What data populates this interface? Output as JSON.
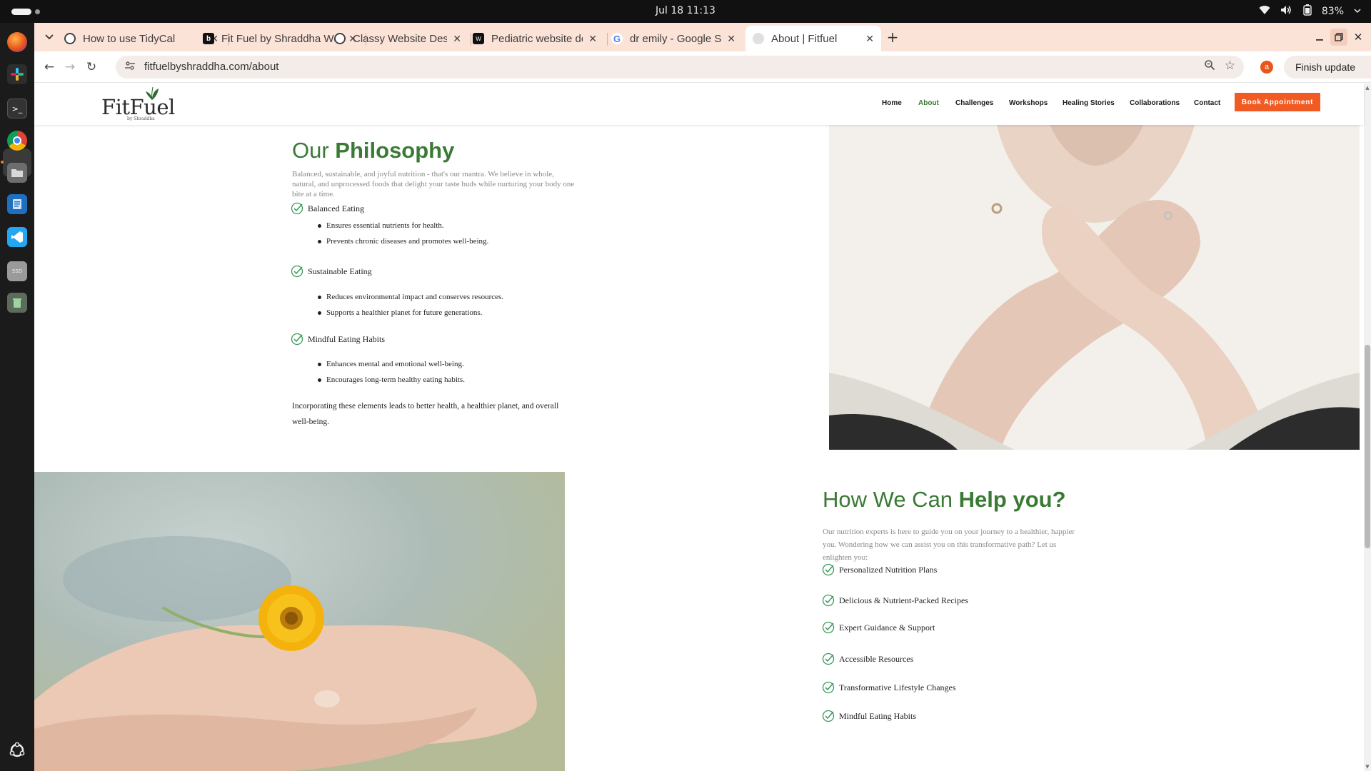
{
  "os": {
    "clock": "Jul 18  11:13",
    "battery": "83%"
  },
  "browser": {
    "tabs": [
      {
        "title": "How to use TidyCal",
        "active": false
      },
      {
        "title": "Fit Fuel by Shraddha Web",
        "active": false
      },
      {
        "title": "Classy Website Design Pr",
        "active": false
      },
      {
        "title": "Pediatric website design",
        "active": false
      },
      {
        "title": "dr emily - Google Search",
        "active": false
      },
      {
        "title": "About | Fitfuel",
        "active": true
      }
    ],
    "url": "fitfuelbyshraddha.com/about",
    "profile_initial": "a",
    "finish_update": "Finish update"
  },
  "site": {
    "logo": {
      "name": "FitFuel",
      "tagline": "by Shraddha"
    },
    "nav": [
      "Home",
      "About",
      "Challenges",
      "Workshops",
      "Healing Stories",
      "Collaborations",
      "Contact"
    ],
    "active_nav": "About",
    "cta": "Book Appointment",
    "colors": {
      "accent_green": "#3a7a35",
      "cta_orange": "#f15a22"
    }
  },
  "philosophy": {
    "title_light": "Our ",
    "title_bold": "Philosophy",
    "lead": "Balanced, sustainable, and joyful nutrition - that's our mantra. We believe in whole, natural, and unprocessed foods that delight your taste buds while nurturing your body one bite at a time.",
    "items": [
      {
        "label": "Balanced Eating",
        "bullets": [
          "Ensures essential nutrients for health.",
          "Prevents chronic diseases and promotes well-being."
        ]
      },
      {
        "label": "Sustainable Eating",
        "bullets": [
          "Reduces environmental impact and conserves resources.",
          "Supports a healthier planet for future generations."
        ]
      },
      {
        "label": "Mindful Eating Habits",
        "bullets": [
          "Enhances mental and emotional well-being.",
          "Encourages long-term healthy eating habits."
        ]
      }
    ],
    "closing": "Incorporating these elements leads to better health, a healthier planet, and overall well-being."
  },
  "help": {
    "title_light": "How We Can ",
    "title_bold": "Help you?",
    "lead": "Our nutrition experts is here to guide you on your journey to a healthier, happier you. Wondering how we can assist you on this transformative path? Let us enlighten you:",
    "items": [
      "Personalized Nutrition Plans",
      "Delicious & Nutrient-Packed Recipes",
      "Expert Guidance & Support",
      "Accessible Resources",
      "Transformative Lifestyle Changes",
      "Mindful Eating Habits"
    ]
  }
}
